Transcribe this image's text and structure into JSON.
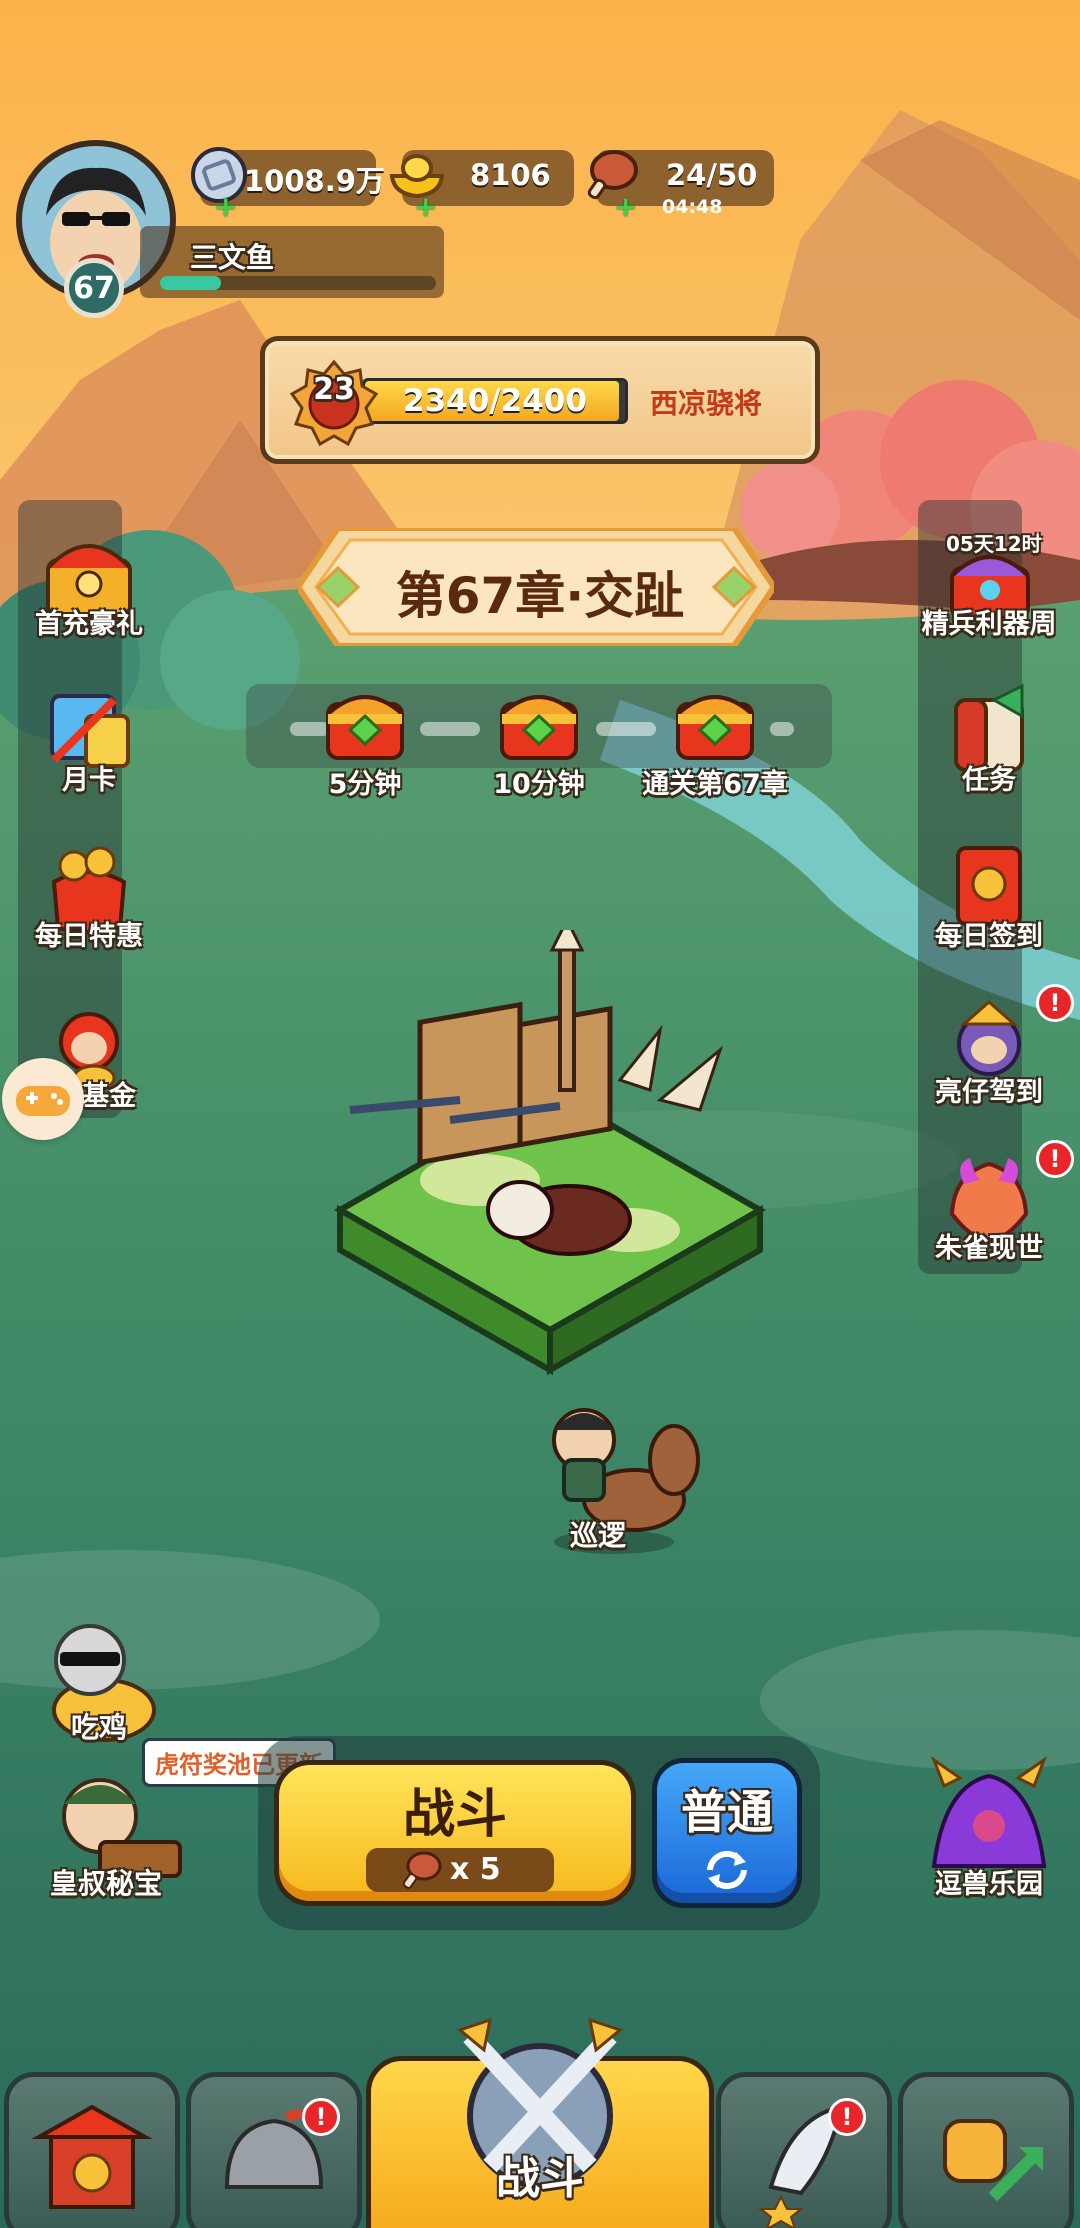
{
  "player": {
    "name": "三文鱼",
    "level": "67",
    "xp_progress": 0.22
  },
  "resources": {
    "silver": "1008.9万",
    "gold": "8106",
    "stamina": "24/50",
    "stamina_timer": "04:48"
  },
  "rank": {
    "level": "23",
    "progress_text": "2340/2400",
    "progress": 0.975,
    "title": "西凉骁将"
  },
  "chapter": {
    "title": "第67章·交趾"
  },
  "rewards": [
    {
      "label": "5分钟"
    },
    {
      "label": "10分钟"
    },
    {
      "label": "通关第67章"
    }
  ],
  "left_menu": [
    {
      "label": "首充豪礼"
    },
    {
      "label": "月卡"
    },
    {
      "label": "每日特惠"
    },
    {
      "label": "基金"
    }
  ],
  "right_menu": [
    {
      "label": "精兵利器周",
      "timer": "05天12时"
    },
    {
      "label": "任务"
    },
    {
      "label": "每日签到"
    },
    {
      "label": "亮仔驾到",
      "alert": "!"
    },
    {
      "label": "朱雀现世",
      "alert": "!"
    }
  ],
  "scene": {
    "unit_label": "巡逻"
  },
  "bottom_left": [
    {
      "label": "吃鸡"
    },
    {
      "label": "皇叔秘宝"
    }
  ],
  "tooltip": "虎符奖池已更新",
  "battle": {
    "label": "战斗",
    "cost": "x 5"
  },
  "mode": {
    "label": "普通"
  },
  "bottom_right": {
    "label": "逗兽乐园"
  },
  "nav": {
    "center_label": "战斗",
    "alert": "!"
  },
  "colors": {
    "sky_top": "#f9b04a",
    "grass": "#3c8a64",
    "battle_yellow": "#f7b81c",
    "mode_blue": "#1a66d8",
    "alert_red": "#e8262a"
  }
}
